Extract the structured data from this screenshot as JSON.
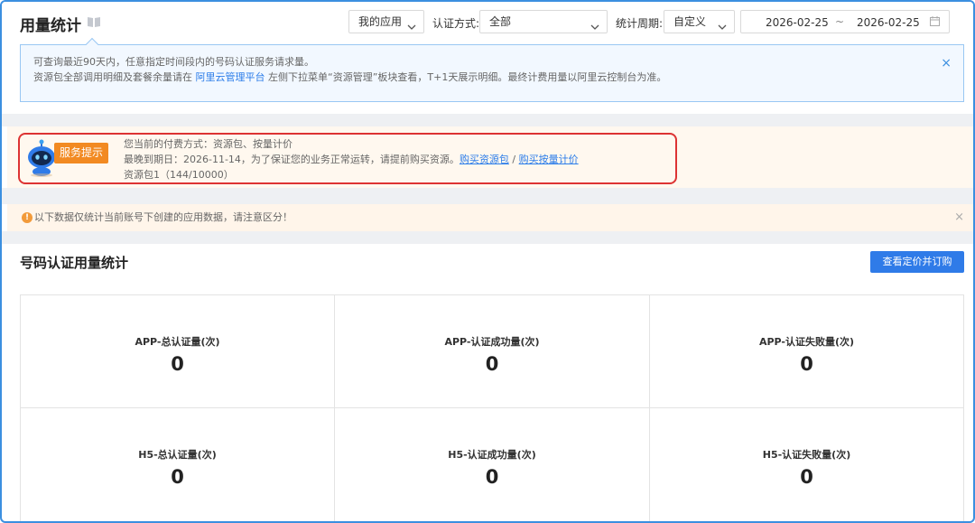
{
  "header": {
    "title": "用量统计",
    "app_select": "我的应用",
    "auth_label": "认证方式:",
    "auth_select": "全部",
    "period_label": "统计周期:",
    "period_select": "自定义",
    "date_start": "2026-02-25",
    "date_sep": "~",
    "date_end": "2026-02-25"
  },
  "info_banner": {
    "line1": "可查询最近90天内，任意指定时间段内的号码认证服务请求量。",
    "line2_prefix": "资源包全部调用明细及套餐余量请在 ",
    "line2_link": "阿里云管理平台",
    "line2_suffix": " 左侧下拉菜单“资源管理”板块查看，T+1天展示明细。最终计费用量以阿里云控制台为准。",
    "close": "×"
  },
  "service_tip": {
    "badge": "服务提示",
    "line1": "您当前的付费方式：资源包、按量计价",
    "line2_prefix": "最晚到期日：2026-11-14，为了保证您的业务正常运转，请提前购买资源。",
    "link_buy_package": "购买资源包",
    "link_sep": " / ",
    "link_buy_usage": "购买按量计价",
    "line3": "资源包1（144/10000）"
  },
  "warning": {
    "icon": "!",
    "text": "以下数据仅统计当前账号下创建的应用数据，请注意区分！",
    "close": "×"
  },
  "stats": {
    "title": "号码认证用量统计",
    "button": "查看定价并订购",
    "cells": [
      {
        "label": "APP-总认证量(次)",
        "value": "0"
      },
      {
        "label": "APP-认证成功量(次)",
        "value": "0"
      },
      {
        "label": "APP-认证失败量(次)",
        "value": "0"
      },
      {
        "label": "H5-总认证量(次)",
        "value": "0"
      },
      {
        "label": "H5-认证成功量(次)",
        "value": "0"
      },
      {
        "label": "H5-认证失败量(次)",
        "value": "0"
      }
    ]
  },
  "colors": {
    "accent": "#2f7be8",
    "highlight_border": "#dd3333",
    "badge": "#f28a22",
    "warning": "#f29a3a"
  }
}
